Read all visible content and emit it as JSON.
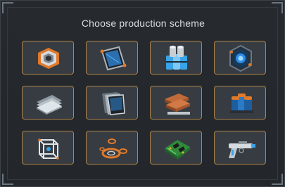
{
  "dialog": {
    "title": "Choose production scheme"
  },
  "schemes": [
    {
      "icon": "hexagon-armor-plate-icon"
    },
    {
      "icon": "energy-panel-icon"
    },
    {
      "icon": "capacitor-cluster-icon"
    },
    {
      "icon": "reactor-core-icon"
    },
    {
      "icon": "alloy-sheet-stack-icon"
    },
    {
      "icon": "metal-plates-icon"
    },
    {
      "icon": "copper-ingot-stack-icon"
    },
    {
      "icon": "battery-cells-icon"
    },
    {
      "icon": "wireframe-cube-icon"
    },
    {
      "icon": "orange-rings-icon"
    },
    {
      "icon": "circuit-board-icon"
    },
    {
      "icon": "laser-pistol-icon"
    }
  ],
  "colors": {
    "slot_border": "#b08446",
    "slot_bg": "#363c42",
    "title_text": "#d9dde1",
    "accent_orange": "#e0792a",
    "accent_blue": "#3aa4e8"
  }
}
